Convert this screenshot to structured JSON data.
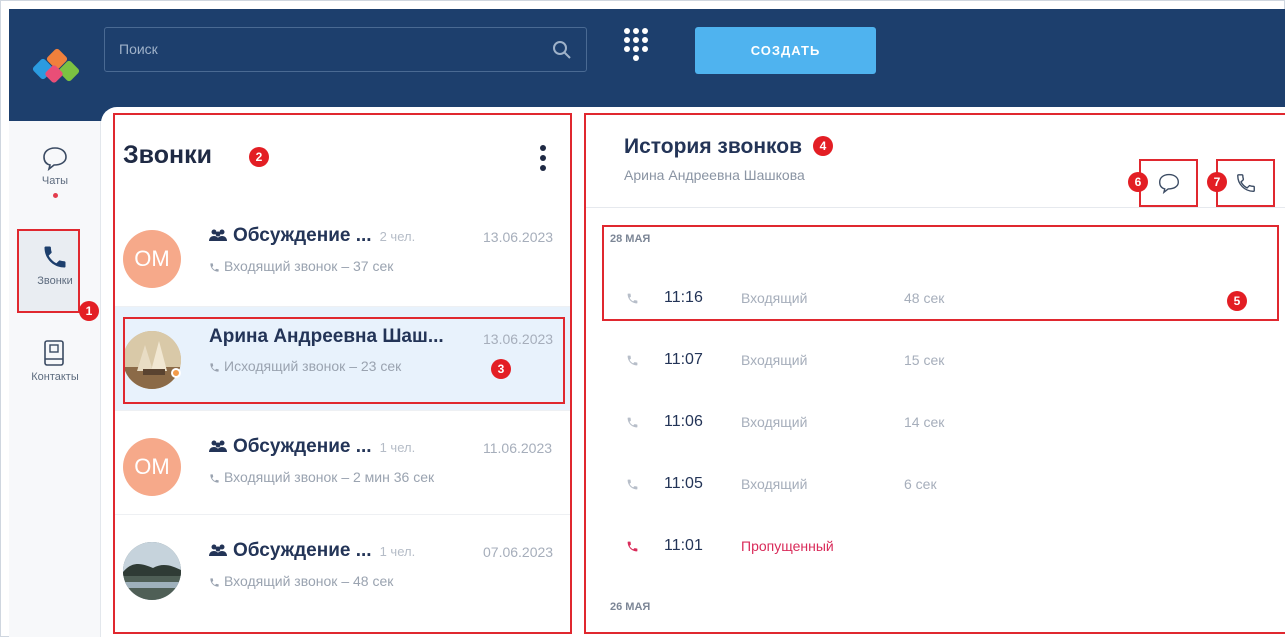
{
  "search": {
    "placeholder": "Поиск"
  },
  "toolbar": {
    "create_label": "СОЗДАТЬ"
  },
  "nav": {
    "items": [
      {
        "label": "Чаты"
      },
      {
        "label": "Звонки"
      },
      {
        "label": "Контакты"
      }
    ]
  },
  "calls": {
    "title": "Звонки",
    "items": [
      {
        "initials": "ОМ",
        "name": "Обсуждение ...",
        "members": "2 чел.",
        "date": "13.06.2023",
        "sub": "Входящий звонок – 37 сек",
        "group": true,
        "avatar_color": "#f6a98a"
      },
      {
        "initials": "",
        "name": "Арина Андреевна Шаш...",
        "members": "",
        "date": "13.06.2023",
        "sub": "Исходящий звонок – 23 сек",
        "group": false,
        "selected": true
      },
      {
        "initials": "ОМ",
        "name": "Обсуждение ...",
        "members": "1 чел.",
        "date": "11.06.2023",
        "sub": "Входящий звонок – 2 мин 36 сек",
        "group": true,
        "avatar_color": "#f6a98a"
      },
      {
        "initials": "",
        "name": "Обсуждение ...",
        "members": "1 чел.",
        "date": "07.06.2023",
        "sub": "Входящий звонок – 48 сек",
        "group": true
      }
    ]
  },
  "history": {
    "title": "История звонков",
    "subtitle": "Арина Андреевна Шашкова",
    "days": [
      {
        "label": "28 МАЯ",
        "entries": [
          {
            "time": "11:16",
            "type": "Входящий",
            "duration": "48 сек"
          },
          {
            "time": "11:07",
            "type": "Входящий",
            "duration": "15 сек"
          },
          {
            "time": "11:06",
            "type": "Входящий",
            "duration": "14 сек"
          },
          {
            "time": "11:05",
            "type": "Входящий",
            "duration": "6 сек"
          },
          {
            "time": "11:01",
            "type": "Пропущенный",
            "duration": "",
            "missed": true
          }
        ]
      },
      {
        "label": "26 МАЯ",
        "entries": []
      }
    ]
  },
  "badges": [
    "1",
    "2",
    "3",
    "4",
    "5",
    "6",
    "7"
  ],
  "colors": {
    "topbar": "#1d3f6d",
    "accent": "#4fb3ef",
    "highlight": "#e0282f",
    "missed": "#d92b5a"
  }
}
